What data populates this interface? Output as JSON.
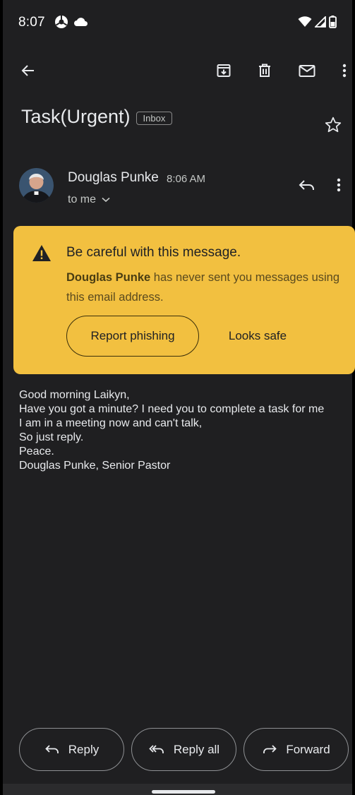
{
  "status_bar": {
    "time": "8:07",
    "left_icons": [
      "chrome-icon",
      "cloud-icon"
    ],
    "right_icons": [
      "wifi-icon",
      "signal-icon",
      "battery-icon"
    ]
  },
  "toolbar": {
    "back_icon": "arrow-back-icon",
    "archive_icon": "archive-icon",
    "delete_icon": "trash-icon",
    "mark_unread_icon": "mail-icon",
    "more_icon": "more-vert-icon"
  },
  "email": {
    "subject": "Task(Urgent)",
    "label_chip": "Inbox",
    "sender_name": "Douglas Punke",
    "time": "8:06 AM",
    "recipient": "to me",
    "body_lines": [
      "Good morning Laikyn,",
      "Have you got a minute? I need you to complete a task for me",
      "I am in a meeting now and can't talk,",
      "So just reply.",
      "Peace.",
      "Douglas Punke, Senior Pastor"
    ]
  },
  "warning": {
    "title": "Be careful with this message.",
    "sender_bold": "Douglas Punke",
    "body_rest": " has never sent you messages using this email address.",
    "report_label": "Report phishing",
    "safe_label": "Looks safe",
    "color": "#f2c040"
  },
  "actions": {
    "reply": "Reply",
    "reply_all": "Reply all",
    "forward": "Forward"
  },
  "colors": {
    "background": "#1f1f21",
    "text": "#e8eaed",
    "secondary_text": "#c4c7c5"
  }
}
